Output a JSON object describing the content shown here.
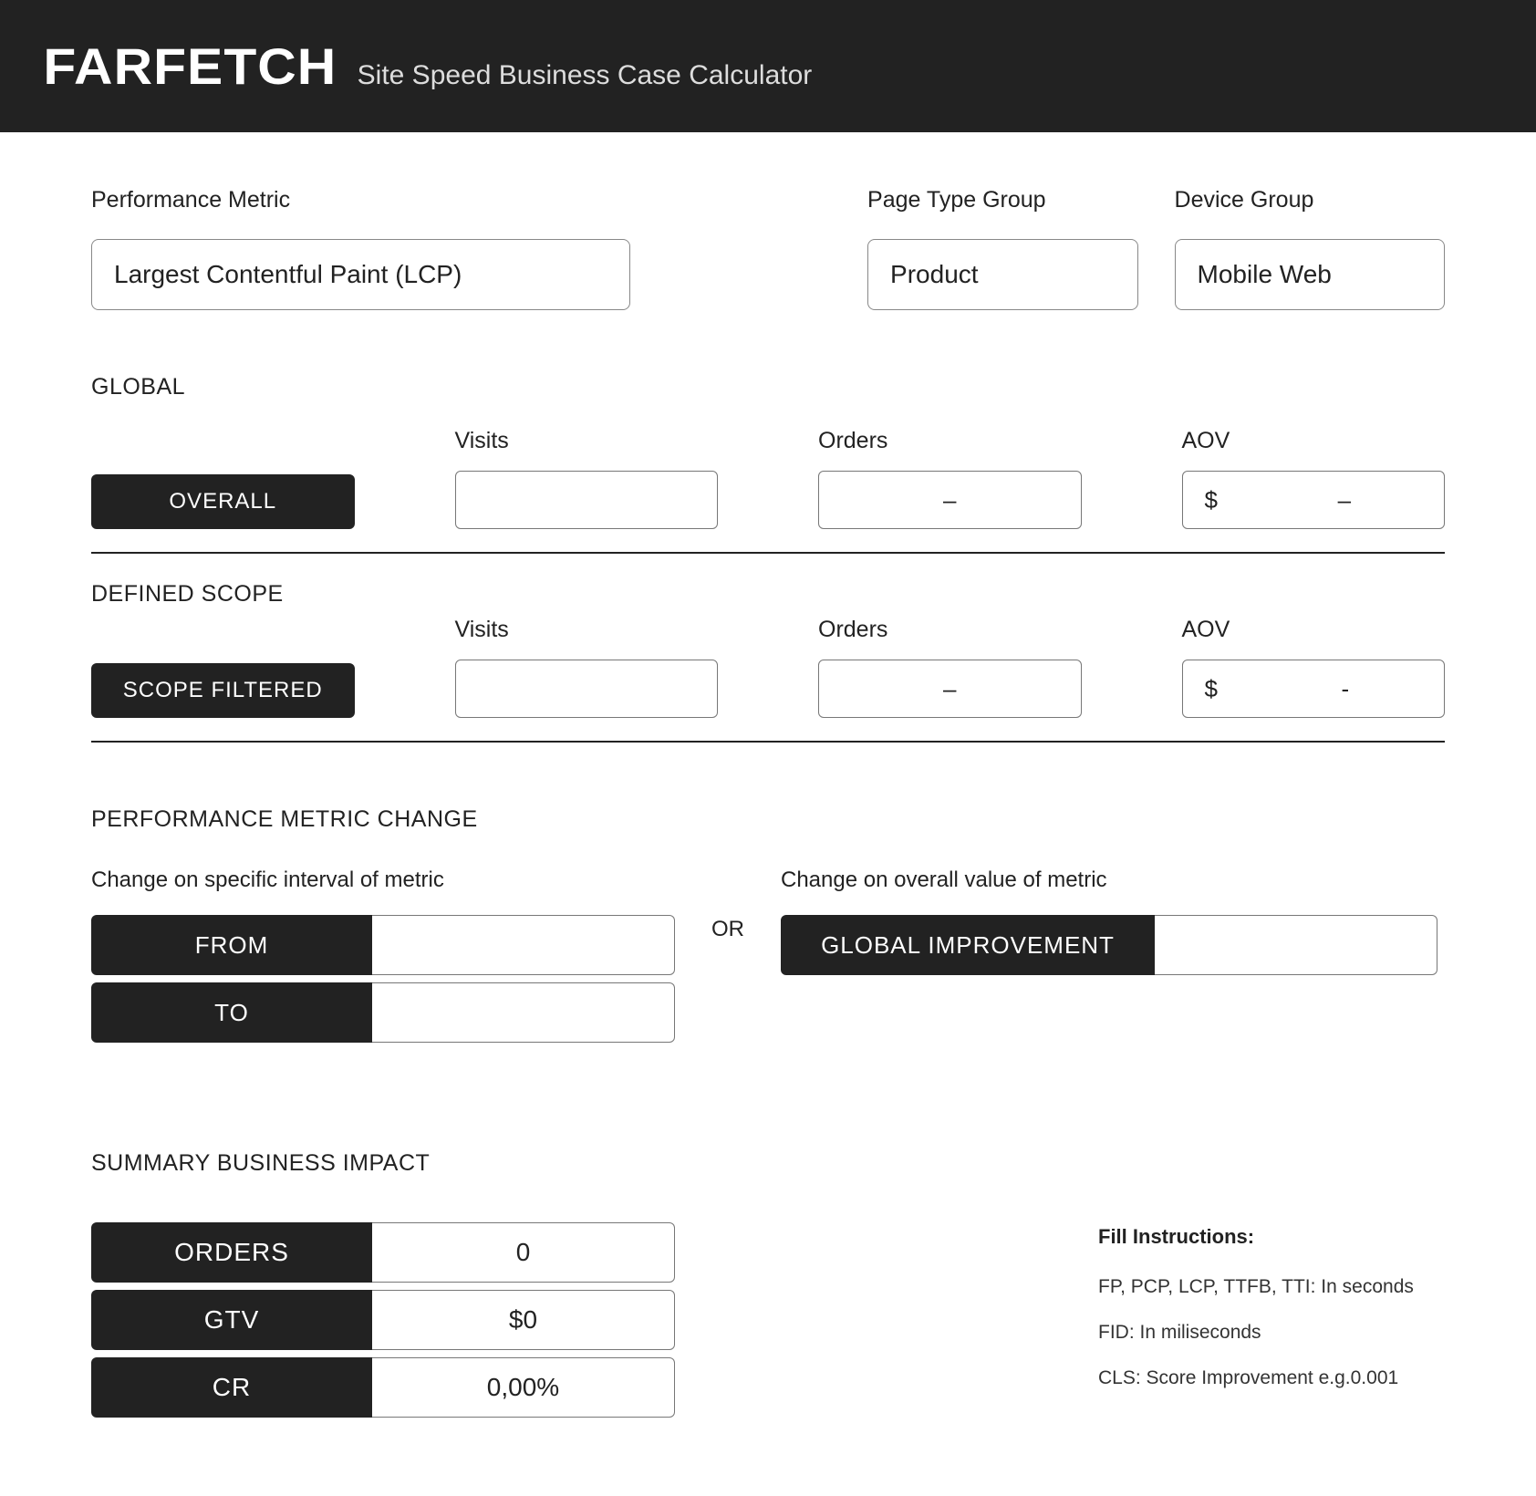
{
  "header": {
    "logo": "FARFETCH",
    "subtitle": "Site Speed Business Case Calculator"
  },
  "filters": {
    "perf_metric": {
      "label": "Performance Metric",
      "value": "Largest Contentful Paint (LCP)"
    },
    "page_type": {
      "label": "Page Type Group",
      "value": "Product"
    },
    "device": {
      "label": "Device Group",
      "value": "Mobile Web"
    }
  },
  "global": {
    "title": "GLOBAL",
    "pill": "OVERALL",
    "visits_label": "Visits",
    "orders_label": "Orders",
    "aov_label": "AOV",
    "visits_value": "",
    "orders_value": "–",
    "aov_currency": "$",
    "aov_value": "–"
  },
  "scope": {
    "title": "DEFINED SCOPE",
    "pill": "SCOPE FILTERED",
    "visits_label": "Visits",
    "orders_label": "Orders",
    "aov_label": "AOV",
    "visits_value": "",
    "orders_value": "–",
    "aov_currency": "$",
    "aov_value": "-"
  },
  "perf_change": {
    "title": "PERFORMANCE METRIC CHANGE",
    "interval_label": "Change on specific interval of metric",
    "overall_label": "Change on overall value of metric",
    "from": "FROM",
    "to": "TO",
    "or": "OR",
    "global_improvement": "GLOBAL IMPROVEMENT",
    "from_value": "",
    "to_value": "",
    "global_value": ""
  },
  "summary": {
    "title": "SUMMARY BUSINESS IMPACT",
    "orders_label": "ORDERS",
    "orders_value": "0",
    "gtv_label": "GTV",
    "gtv_value": "$0",
    "cr_label": "CR",
    "cr_value": "0,00%"
  },
  "instructions": {
    "title": "Fill Instructions:",
    "line1": "FP, PCP, LCP, TTFB, TTI: In seconds",
    "line2": "FID: In miliseconds",
    "line3": "CLS: Score Improvement e.g.0.001"
  }
}
